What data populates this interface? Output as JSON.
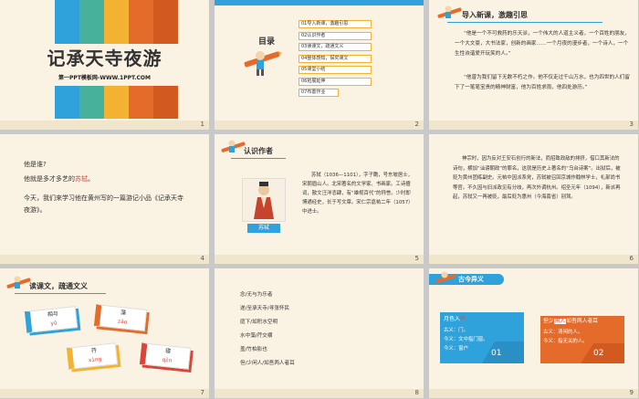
{
  "colors": {
    "bg": "#faf3e3",
    "blue": "#2fa2db",
    "teal": "#47b19c",
    "yellow": "#f4b233",
    "orange": "#e56b2b",
    "red": "#d8463a"
  },
  "slide1": {
    "number": "1",
    "title": "记承天寺夜游",
    "subtitle": "第一PPT模板网-WWW.1PPT.COM",
    "bar_colors": [
      "#2fa2db",
      "#47b19c",
      "#f4b233",
      "#e56b2b",
      "#d35a1f"
    ]
  },
  "slide2": {
    "number": "2",
    "heading": "目录",
    "items": [
      "01导入新课，激趣引思",
      "02认识作者",
      "03读课文，疏通文义",
      "04整体感知，探究课文",
      "05课堂小结",
      "06拓展延伸",
      "07布置作业"
    ]
  },
  "slide3": {
    "number": "3",
    "heading": "导入新课，激趣引思",
    "para1": "“他是一个不可救药的乐天派，一个伟大的人道主义者，一个百姓的朋友，一个大文豪，大书法家，创新的画家……一个月夜的漫步者，一个诗人，一个生性诙谐爱开玩笑的人。”",
    "para2": "“他曾为我们留下无数不朽之作。他不仅走过千山万水，也为四世的人们留下了一笔笔宝贵的精神财富，他为百姓求雨，他四处游历。”"
  },
  "slide4": {
    "number": "4",
    "line1": "他是谁?",
    "line2_prefix": "他就是多才多艺的",
    "line2_name": "苏轼",
    "line2_suffix": "。",
    "line3": "今天，我们来学习他在黄州写的一篇游记小品《记承天寺夜游》。"
  },
  "slide5": {
    "number": "5",
    "heading": "认识作者",
    "caption": "苏轼",
    "bio": "苏轼（1036—1101），字子瞻，号东坡居士，宋朝眉山人。北宋著名的文学家、书画家。工诗擅词，散文汪洋恣肆，有“雄视百代”的称誉。少时即博通经史，长于写文章。宋仁宗嘉祐二年（1057）中进士。"
  },
  "slide6": {
    "number": "6",
    "text": "神宗时，因为反对王安石创行的新法，而招致政敌的排挤，借口其新法的诗句，横加“讪谤朝政”的罪名，这就是历史上著名的“乌台诗案”。出狱后，被贬为黄州团练副史。元祐中因派系党，苏轼被召回京城作翰林学士，礼部尚书等官。不久因与旧派政见有分歧，再次外调杭州。绍圣元年（1094），新派再起，苏轼又一再被贬，最后贬为惠州（今海南省）别驾。"
  },
  "slide7": {
    "number": "7",
    "heading": "读课文，疏通文义",
    "cards": [
      {
        "char": "相与",
        "pinyin": "yǔ",
        "color": "#2fa2db"
      },
      {
        "char": "藻",
        "pinyin": "zǎo",
        "color": "#e56b2b"
      },
      {
        "char": "荇",
        "pinyin": "xìng",
        "color": "#f4b233"
      },
      {
        "char": "寝",
        "pinyin": "qǐn",
        "color": "#d8463a"
      }
    ]
  },
  "slide8": {
    "number": "8",
    "lines": [
      "念/无与为乐者",
      "遂/至承天寺/寻张怀民",
      "庭下/如积水空明",
      "水中藻/荇交横",
      "盖/竹柏影也",
      "但/少闲人/如吾两人者耳"
    ]
  },
  "slide9": {
    "number": "9",
    "heading": "古今异义",
    "left": {
      "title_prefix": "月色入",
      "title_hl": "户",
      "line1": "古义：门。",
      "line2": "今义：文中指门窗。",
      "line3": "今义：窗户",
      "badge": "01"
    },
    "right": {
      "title_prefix": "但少",
      "title_hl": "闲人",
      "title_suffix": "如吾两人者耳",
      "line1": "古义：清闲的人。",
      "line2": "今义：指无关的人。",
      "badge": "02"
    }
  }
}
